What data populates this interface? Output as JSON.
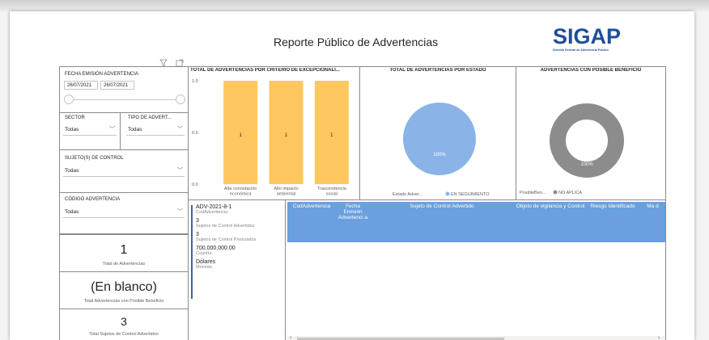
{
  "report": {
    "title": "Reporte Público de Advertencias",
    "logo_text": "SIGAP",
    "logo_subtitle": "Sistema General de Advertencia Público"
  },
  "filters": {
    "fecha": {
      "label": "FECHA EMISIÓN ADVERTENCIA",
      "start": "26/07/2021",
      "end": "26/07/2021"
    },
    "sector": {
      "label": "SECTOR",
      "value": "Todas"
    },
    "tipo": {
      "label": "TIPO DE ADVERT...",
      "value": "Todas"
    },
    "sujeto": {
      "label": "SUJETO(S) DE CONTROL",
      "value": "Todas"
    },
    "codigo": {
      "label": "CÓDIGO ADVERTENCIA",
      "value": "Todas"
    }
  },
  "cards": {
    "total": {
      "value": "1",
      "label": "Total de Advertencias"
    },
    "beneficio": {
      "value": "(En blanco)",
      "label": "Total Advertencias con Posible Beneficio"
    },
    "sujetos": {
      "value": "3",
      "label": "Total Sujetos de Control Advertidos"
    }
  },
  "chart_data": [
    {
      "type": "bar",
      "title": "TOTAL DE ADVERTENCIAS POR CRITERIO DE EXCEPCIONALI...",
      "categories": [
        "Alta connotación económica",
        "Alto impacto ambiental",
        "Trascendencia social"
      ],
      "category_lines": [
        [
          "Alta connotación",
          "económica"
        ],
        [
          "Alto impacto",
          "ambiental"
        ],
        [
          "Trascendencia",
          "social"
        ]
      ],
      "values": [
        1,
        1,
        1
      ],
      "ylim": [
        0,
        1
      ],
      "yticks": [
        "1.0",
        "0.5",
        "0.0"
      ],
      "color": "#ffc75f"
    },
    {
      "type": "pie",
      "title": "TOTAL DE ADVERTENCIAS POR ESTADO",
      "slices": [
        {
          "name": "EN SEGUIMIENTO",
          "value": 100,
          "label": "100%",
          "color": "#8ab4e8"
        }
      ],
      "legend_title": "Estado Adver...",
      "legend_placement": "bottom-left"
    },
    {
      "type": "pie",
      "title": "ADVERTENCIAS CON POSIBLE BENEFICIO",
      "donut": true,
      "slices": [
        {
          "name": "NO APLICA",
          "value": 100,
          "label": "100%",
          "color": "#8c8c8c"
        }
      ],
      "legend_title": "PosibleBen...",
      "legend_placement": "bottom-left"
    }
  ],
  "detail": [
    {
      "value": "ADV-2021-8-1",
      "label": "CodAdvertencia"
    },
    {
      "value": "3",
      "label": "Sujetos de Control Advertidos"
    },
    {
      "value": "3",
      "label": "Sujetos de Control Priorizados"
    },
    {
      "value": "700,000,000.00",
      "label": "Cuantía"
    },
    {
      "value": "Dólares",
      "label": "Moneda"
    }
  ],
  "table": {
    "columns": [
      "CodAdvertencia",
      "Fecha Emisión Advertenci a",
      "Sujeto de Control Advertido",
      "Objeto de vigilancia y Control",
      "Riesgo Identificado",
      "Ma d"
    ],
    "header_color": "#6a9fe0"
  }
}
